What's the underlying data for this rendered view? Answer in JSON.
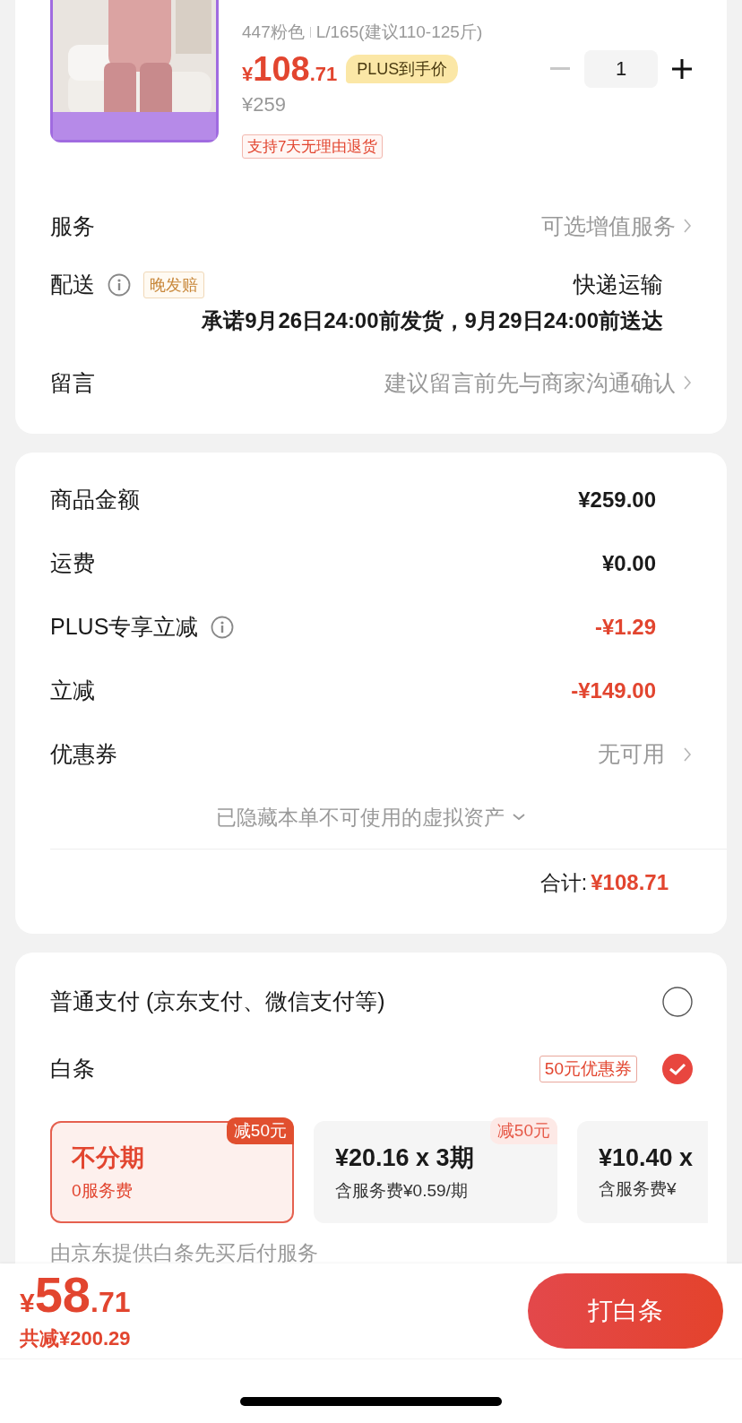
{
  "product": {
    "spec": "447粉色",
    "size": "L/165(建议110-125斤)",
    "price_symbol": "¥",
    "price_int": "108",
    "price_dec": ".71",
    "price_tag": "PLUS到手价",
    "original_price": "¥259",
    "return_tag": "支持7天无理由退货",
    "quantity": "1",
    "minus_disabled": true
  },
  "service": {
    "label": "服务",
    "value": "可选增值服务"
  },
  "delivery": {
    "label": "配送",
    "badge": "晚发赔",
    "method": "快递运输",
    "promise": "承诺9月26日24:00前发货，9月29日24:00前送达"
  },
  "message": {
    "label": "留言",
    "value": "建议留言前先与商家沟通确认"
  },
  "summary": {
    "rows": [
      {
        "label": "商品金额",
        "value": "¥259.00",
        "kind": "plain",
        "info": false
      },
      {
        "label": "运费",
        "value": "¥0.00",
        "kind": "plain",
        "info": false
      },
      {
        "label": "PLUS专享立减",
        "value": "-¥1.29",
        "kind": "discount",
        "info": true
      },
      {
        "label": "立减",
        "value": "-¥149.00",
        "kind": "discount",
        "info": false
      },
      {
        "label": "优惠券",
        "value": "无可用",
        "kind": "link",
        "info": false
      }
    ],
    "hidden_note": "已隐藏本单不可使用的虚拟资产",
    "total_label": "合计:",
    "total": "¥108.71"
  },
  "payment": {
    "options": [
      {
        "label": "普通支付 (京东支付、微信支付等)",
        "selected": false
      },
      {
        "label": "白条",
        "coupon": "50元优惠券",
        "selected": true
      }
    ],
    "plans": [
      {
        "title": "不分期",
        "subtitle": "0服务费",
        "badge": "减50元",
        "selected": true
      },
      {
        "title": "¥20.16 x 3期",
        "subtitle": "含服务费¥0.59/期",
        "badge": "减50元",
        "selected": false
      },
      {
        "title": "¥10.40 x",
        "subtitle": "含服务费¥",
        "selected": false
      }
    ],
    "note": "由京东提供白条先买后付服务"
  },
  "checkout": {
    "price_symbol": "¥",
    "price_int": "58",
    "price_dec": ".71",
    "saved": "共减¥200.29",
    "button": "打白条"
  }
}
